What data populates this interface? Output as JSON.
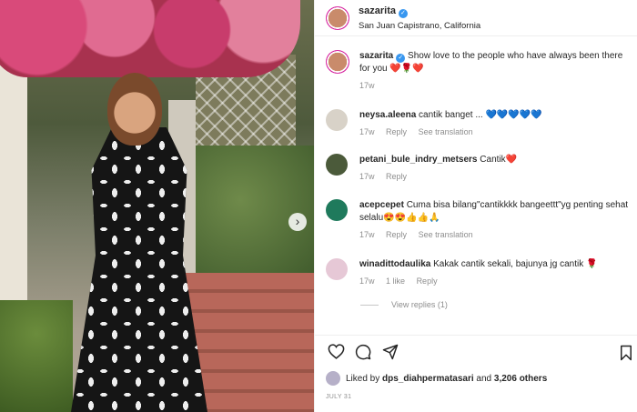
{
  "post": {
    "username": "sazarita",
    "location": "San Juan Capistrano, California",
    "caption": "Show love to the people who have always been there for you ❤️🌹❤️",
    "caption_time": "17w"
  },
  "comments": [
    {
      "username": "neysa.aleena",
      "text": "cantik banget ...",
      "hearts": "💙💙💙💙💙",
      "time": "17w",
      "reply": "Reply",
      "translate": "See translation"
    },
    {
      "username": "petani_bule_indry_metsers",
      "text": "Cantik",
      "hearts": "❤️",
      "time": "17w",
      "reply": "Reply"
    },
    {
      "username": "acepcepet",
      "text": "Cuma bisa bilang\"cantikkkk bangeettt\"yg penting sehat selalu",
      "hearts": "😍😍👍👍🙏",
      "time": "17w",
      "reply": "Reply",
      "translate": "See translation"
    },
    {
      "username": "winadittodaulika",
      "text": "Kakak cantik sekali, bajunya jg cantik 🌹",
      "time": "17w",
      "likes": "1 like",
      "reply": "Reply"
    }
  ],
  "view_replies": "View replies (1)",
  "likes": {
    "prefix": "Liked by",
    "user": "dps_diahpermatasari",
    "suffix": "and",
    "others": "3,206 others"
  },
  "date": "JULY 31",
  "colors": {
    "verified": "#3897f0",
    "secondary_text": "#8e8e8e",
    "heart": "#e8224b"
  }
}
